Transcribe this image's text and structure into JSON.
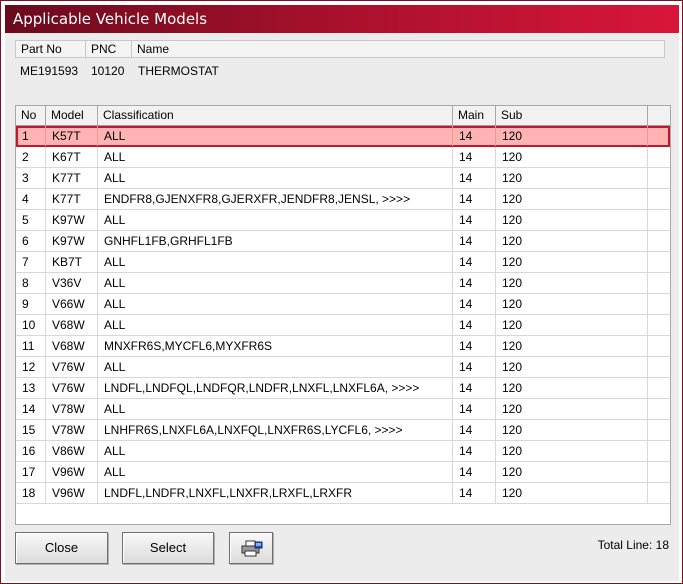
{
  "window": {
    "title": "Applicable Vehicle Models"
  },
  "part": {
    "headers": {
      "part_no": "Part No",
      "pnc": "PNC",
      "name": "Name"
    },
    "values": {
      "part_no": "ME191593",
      "pnc": "10120",
      "name": "THERMOSTAT"
    }
  },
  "grid": {
    "columns": {
      "no": "No",
      "model": "Model",
      "classification": "Classification",
      "main": "Main",
      "sub": "Sub"
    },
    "selected_row": 0,
    "rows": [
      {
        "no": "1",
        "model": "K57T",
        "classification": "ALL",
        "main": "14",
        "sub": "120"
      },
      {
        "no": "2",
        "model": "K67T",
        "classification": "ALL",
        "main": "14",
        "sub": "120"
      },
      {
        "no": "3",
        "model": "K77T",
        "classification": "ALL",
        "main": "14",
        "sub": "120"
      },
      {
        "no": "4",
        "model": "K77T",
        "classification": "ENDFR8,GJENXFR8,GJERXFR,JENDFR8,JENSL,  >>>>",
        "main": "14",
        "sub": "120"
      },
      {
        "no": "5",
        "model": "K97W",
        "classification": "ALL",
        "main": "14",
        "sub": "120"
      },
      {
        "no": "6",
        "model": "K97W",
        "classification": "GNHFL1FB,GRHFL1FB",
        "main": "14",
        "sub": "120"
      },
      {
        "no": "7",
        "model": "KB7T",
        "classification": "ALL",
        "main": "14",
        "sub": "120"
      },
      {
        "no": "8",
        "model": "V36V",
        "classification": "ALL",
        "main": "14",
        "sub": "120"
      },
      {
        "no": "9",
        "model": "V66W",
        "classification": "ALL",
        "main": "14",
        "sub": "120"
      },
      {
        "no": "10",
        "model": "V68W",
        "classification": "ALL",
        "main": "14",
        "sub": "120"
      },
      {
        "no": "11",
        "model": "V68W",
        "classification": "MNXFR6S,MYCFL6,MYXFR6S",
        "main": "14",
        "sub": "120"
      },
      {
        "no": "12",
        "model": "V76W",
        "classification": "ALL",
        "main": "14",
        "sub": "120"
      },
      {
        "no": "13",
        "model": "V76W",
        "classification": "LNDFL,LNDFQL,LNDFQR,LNDFR,LNXFL,LNXFL6A,  >>>>",
        "main": "14",
        "sub": "120"
      },
      {
        "no": "14",
        "model": "V78W",
        "classification": "ALL",
        "main": "14",
        "sub": "120"
      },
      {
        "no": "15",
        "model": "V78W",
        "classification": "LNHFR6S,LNXFL6A,LNXFQL,LNXFR6S,LYCFL6,  >>>>",
        "main": "14",
        "sub": "120"
      },
      {
        "no": "16",
        "model": "V86W",
        "classification": "ALL",
        "main": "14",
        "sub": "120"
      },
      {
        "no": "17",
        "model": "V96W",
        "classification": "ALL",
        "main": "14",
        "sub": "120"
      },
      {
        "no": "18",
        "model": "V96W",
        "classification": "LNDFL,LNDFR,LNXFL,LNXFR,LRXFL,LRXFR",
        "main": "14",
        "sub": "120"
      }
    ]
  },
  "buttons": {
    "close": "Close",
    "select": "Select",
    "print_icon": "printer-icon"
  },
  "footer": {
    "total_line": "Total Line: 18"
  },
  "colors": {
    "title_dark": "#6a0a1e",
    "title_light": "#d8163a",
    "selected_row": "#ffb3b3",
    "selected_border": "#c0182c"
  }
}
